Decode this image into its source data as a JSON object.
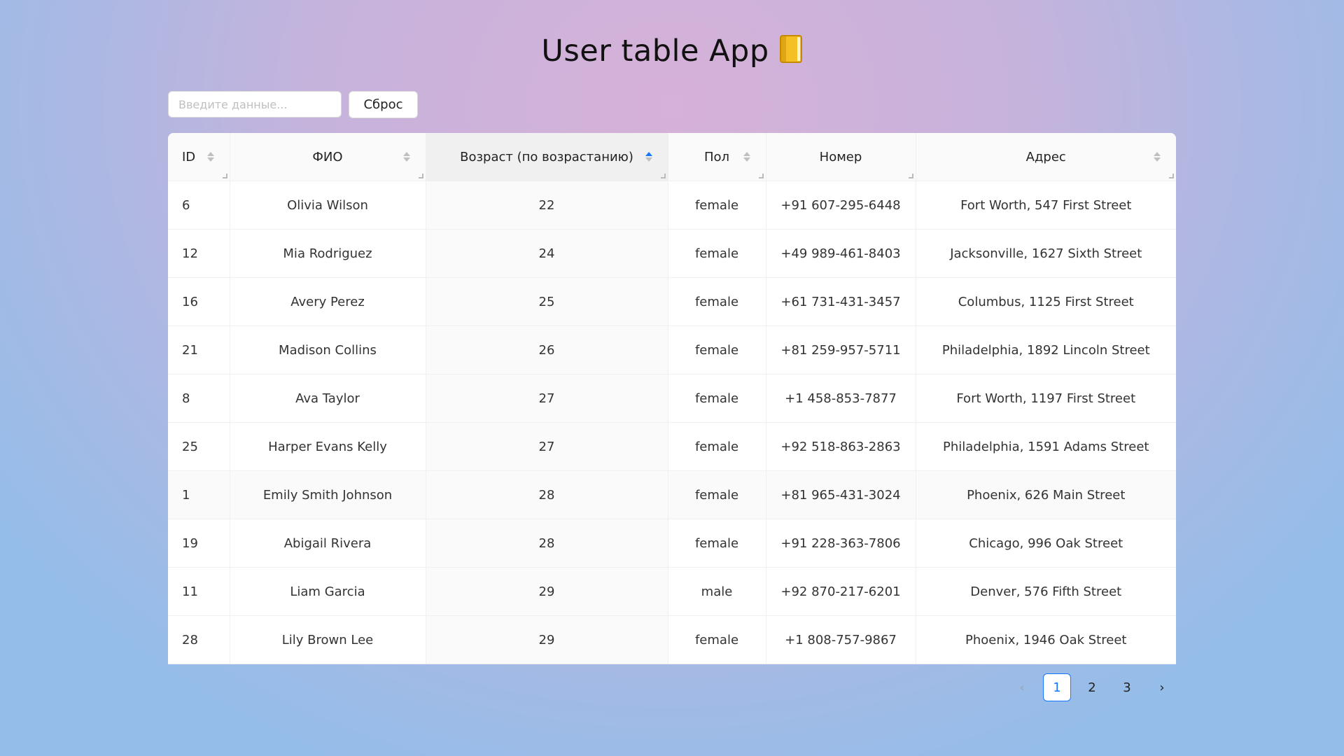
{
  "app": {
    "title": "User table App"
  },
  "filter": {
    "placeholder": "Введите данные...",
    "reset_label": "Сброс"
  },
  "table": {
    "columns": [
      {
        "key": "id",
        "label": "ID",
        "sortable": true,
        "sort": "none",
        "align": "left"
      },
      {
        "key": "fio",
        "label": "ФИО",
        "sortable": true,
        "sort": "none",
        "align": "center"
      },
      {
        "key": "age",
        "label": "Возраст (по возрастанию)",
        "sortable": true,
        "sort": "asc",
        "align": "center"
      },
      {
        "key": "gender",
        "label": "Пол",
        "sortable": true,
        "sort": "none",
        "align": "center"
      },
      {
        "key": "phone",
        "label": "Номер",
        "sortable": false,
        "sort": "none",
        "align": "center"
      },
      {
        "key": "address",
        "label": "Адрес",
        "sortable": true,
        "sort": "none",
        "align": "center"
      }
    ],
    "rows": [
      {
        "id": "6",
        "fio": "Olivia Wilson",
        "age": "22",
        "gender": "female",
        "phone": "+91 607-295-6448",
        "address": "Fort Worth, 547 First Street"
      },
      {
        "id": "12",
        "fio": "Mia Rodriguez",
        "age": "24",
        "gender": "female",
        "phone": "+49 989-461-8403",
        "address": "Jacksonville, 1627 Sixth Street"
      },
      {
        "id": "16",
        "fio": "Avery Perez",
        "age": "25",
        "gender": "female",
        "phone": "+61 731-431-3457",
        "address": "Columbus, 1125 First Street"
      },
      {
        "id": "21",
        "fio": "Madison Collins",
        "age": "26",
        "gender": "female",
        "phone": "+81 259-957-5711",
        "address": "Philadelphia, 1892 Lincoln Street"
      },
      {
        "id": "8",
        "fio": "Ava Taylor",
        "age": "27",
        "gender": "female",
        "phone": "+1 458-853-7877",
        "address": "Fort Worth, 1197 First Street"
      },
      {
        "id": "25",
        "fio": "Harper Evans Kelly",
        "age": "27",
        "gender": "female",
        "phone": "+92 518-863-2863",
        "address": "Philadelphia, 1591 Adams Street"
      },
      {
        "id": "1",
        "fio": "Emily Smith Johnson",
        "age": "28",
        "gender": "female",
        "phone": "+81 965-431-3024",
        "address": "Phoenix, 626 Main Street"
      },
      {
        "id": "19",
        "fio": "Abigail Rivera",
        "age": "28",
        "gender": "female",
        "phone": "+91 228-363-7806",
        "address": "Chicago, 996 Oak Street"
      },
      {
        "id": "11",
        "fio": "Liam Garcia",
        "age": "29",
        "gender": "male",
        "phone": "+92 870-217-6201",
        "address": "Denver, 576 Fifth Street"
      },
      {
        "id": "28",
        "fio": "Lily Brown Lee",
        "age": "29",
        "gender": "female",
        "phone": "+1 808-757-9867",
        "address": "Phoenix, 1946 Oak Street"
      }
    ],
    "hover_row": 6
  },
  "pagination": {
    "prev": "‹",
    "next": "›",
    "pages": [
      "1",
      "2",
      "3"
    ],
    "current": "1"
  },
  "icons": {
    "title_icon": "notebook-icon"
  },
  "colors": {
    "accent": "#1677ff",
    "book": "#f5c024"
  }
}
